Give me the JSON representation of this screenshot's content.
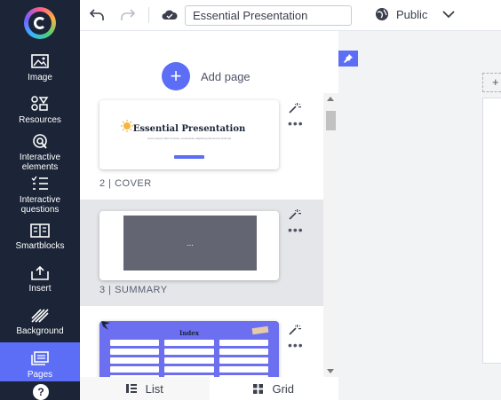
{
  "sidebar": {
    "items": [
      {
        "label": "Image",
        "icon": "image-icon"
      },
      {
        "label": "Resources",
        "icon": "resources-icon"
      },
      {
        "label": "Interactive elements",
        "icon": "interactive-elements-icon"
      },
      {
        "label": "Interactive questions",
        "icon": "interactive-questions-icon"
      },
      {
        "label": "Smartblocks",
        "icon": "smartblocks-icon"
      },
      {
        "label": "Insert",
        "icon": "insert-icon"
      },
      {
        "label": "Background",
        "icon": "background-icon"
      },
      {
        "label": "Pages",
        "icon": "pages-icon",
        "active": true
      }
    ],
    "help_label": "?"
  },
  "toolbar": {
    "title_value": "Essential Presentation",
    "visibility": "Public"
  },
  "pages_panel": {
    "add_page_label": "Add page",
    "pages": [
      {
        "label": "2 | COVER",
        "thumb_title": "Essential Presentation",
        "thumb_subtitle": "Lorem ipsum dolor sit amet, consectetur adipiscing elit sed do eiusmod"
      },
      {
        "label": "3 | SUMMARY",
        "thumb_text": "...",
        "selected": true
      },
      {
        "label": "",
        "thumb_title": "Index"
      }
    ],
    "view_tabs": {
      "list": "List",
      "grid": "Grid"
    }
  },
  "colors": {
    "accent": "#5b6ef5",
    "rail_bg": "#1b2537"
  }
}
